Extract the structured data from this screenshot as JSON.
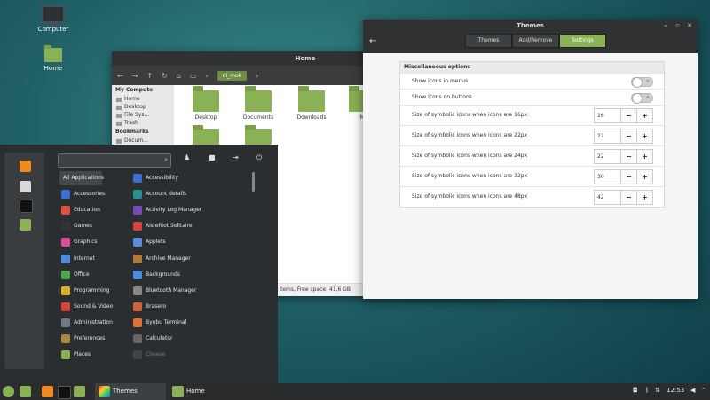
{
  "desktop": {
    "icons": [
      {
        "label": "Computer"
      },
      {
        "label": "Home"
      }
    ]
  },
  "file_manager": {
    "title": "Home",
    "path": "di_mok",
    "sidebar": {
      "sections": [
        {
          "header": "My Compute",
          "items": [
            "Home",
            "Desktop",
            "File Sys...",
            "Trash"
          ]
        },
        {
          "header": "Bookmarks",
          "items": [
            "Docum..."
          ]
        }
      ]
    },
    "items": [
      "Desktop",
      "Documents",
      "Downloads",
      "M"
    ],
    "status": "tems, Free space: 41,6 GB"
  },
  "themes": {
    "title": "Themes",
    "tabs": [
      {
        "label": "Themes"
      },
      {
        "label": "Add/Remove"
      },
      {
        "label": "Settings"
      }
    ],
    "section": "Miscellaneous options",
    "toggles": [
      {
        "label": "Show icons in menus"
      },
      {
        "label": "Show icons on buttons"
      }
    ],
    "spinners": [
      {
        "label": "Size of symbolic icons when icons are 16px",
        "value": "16"
      },
      {
        "label": "Size of symbolic icons when icons are 22px",
        "value": "22"
      },
      {
        "label": "Size of symbolic icons when icons are 24px",
        "value": "22"
      },
      {
        "label": "Size of symbolic icons when icons are 32px",
        "value": "30"
      },
      {
        "label": "Size of symbolic icons when icons are 48px",
        "value": "42"
      }
    ],
    "minus": "−",
    "plus": "+"
  },
  "menu": {
    "search_placeholder": "",
    "categories": [
      "All Applications",
      "Accessories",
      "Education",
      "Games",
      "Graphics",
      "Internet",
      "Office",
      "Programming",
      "Sound & Video",
      "Administration",
      "Preferences",
      "Places"
    ],
    "category_colors": [
      "",
      "#3b6fd6",
      "#e0503a",
      "#333",
      "#d94f9b",
      "#4a8de0",
      "#4aa84a",
      "#d8b22a",
      "#d6423f",
      "#6e7a85",
      "#aa8844",
      "#8bb157"
    ],
    "apps": [
      "Accessibility",
      "Account details",
      "Activity Log Manager",
      "AisleRiot Solitaire",
      "Applets",
      "Archive Manager",
      "Backgrounds",
      "Bluetooth Manager",
      "Brasero",
      "Byobu Terminal",
      "Calculator",
      "Cheese"
    ],
    "app_colors": [
      "#3b6fd6",
      "#2a8f8f",
      "#7a4ab8",
      "#d6423f",
      "#5b8dd6",
      "#b07a3a",
      "#4a8de0",
      "#888",
      "#d6603a",
      "#e07030",
      "#666",
      "#666"
    ]
  },
  "taskbar": {
    "tasks": [
      {
        "label": "Themes"
      },
      {
        "label": "Home"
      }
    ],
    "clock": "12:53"
  }
}
